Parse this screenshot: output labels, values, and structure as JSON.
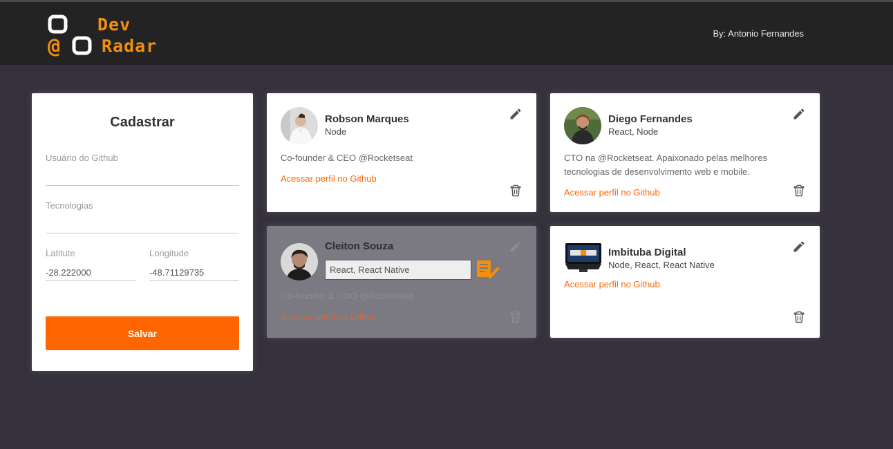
{
  "app": {
    "logo_line1": "Dev",
    "logo_line2": "Radar",
    "author": "By: Antonio Fernandes"
  },
  "form": {
    "title": "Cadastrar",
    "github_label": "Usuário do Github",
    "github_value": "",
    "techs_label": "Tecnologias",
    "techs_value": "",
    "latitude_label": "Latitute",
    "latitude_value": "-28.222000",
    "longitude_label": "Longitude",
    "longitude_value": "-48.71129735",
    "save_label": "Salvar"
  },
  "devs": [
    {
      "name": "Robson Marques",
      "techs": "Node",
      "bio": "Co-founder & CEO @Rocketseat",
      "link": "Acessar perfil no Github"
    },
    {
      "name": "Diego Fernandes",
      "techs": "React, Node",
      "bio": "CTO na @Rocketseat. Apaixonado pelas melhores tecnologias de desenvolvimento web e mobile.",
      "link": "Acessar perfil no Github"
    },
    {
      "name": "Cleiton Souza",
      "techs": "React, React Native",
      "bio": "Co-founder & COO @Rocketseat",
      "link": "Acessar perfil no Github",
      "editing": true
    },
    {
      "name": "Imbituba Digital",
      "techs": "Node, React, React Native",
      "bio": "",
      "link": "Acessar perfil no Github"
    }
  ],
  "icons": {
    "edit": "pencil-icon",
    "delete": "trash-icon",
    "confirm": "checklist-confirm-icon"
  },
  "colors": {
    "background": "#34303c",
    "header": "#232323",
    "accent": "#ff6600",
    "logo": "#f28f0c",
    "editing_card": "#7b7981"
  }
}
